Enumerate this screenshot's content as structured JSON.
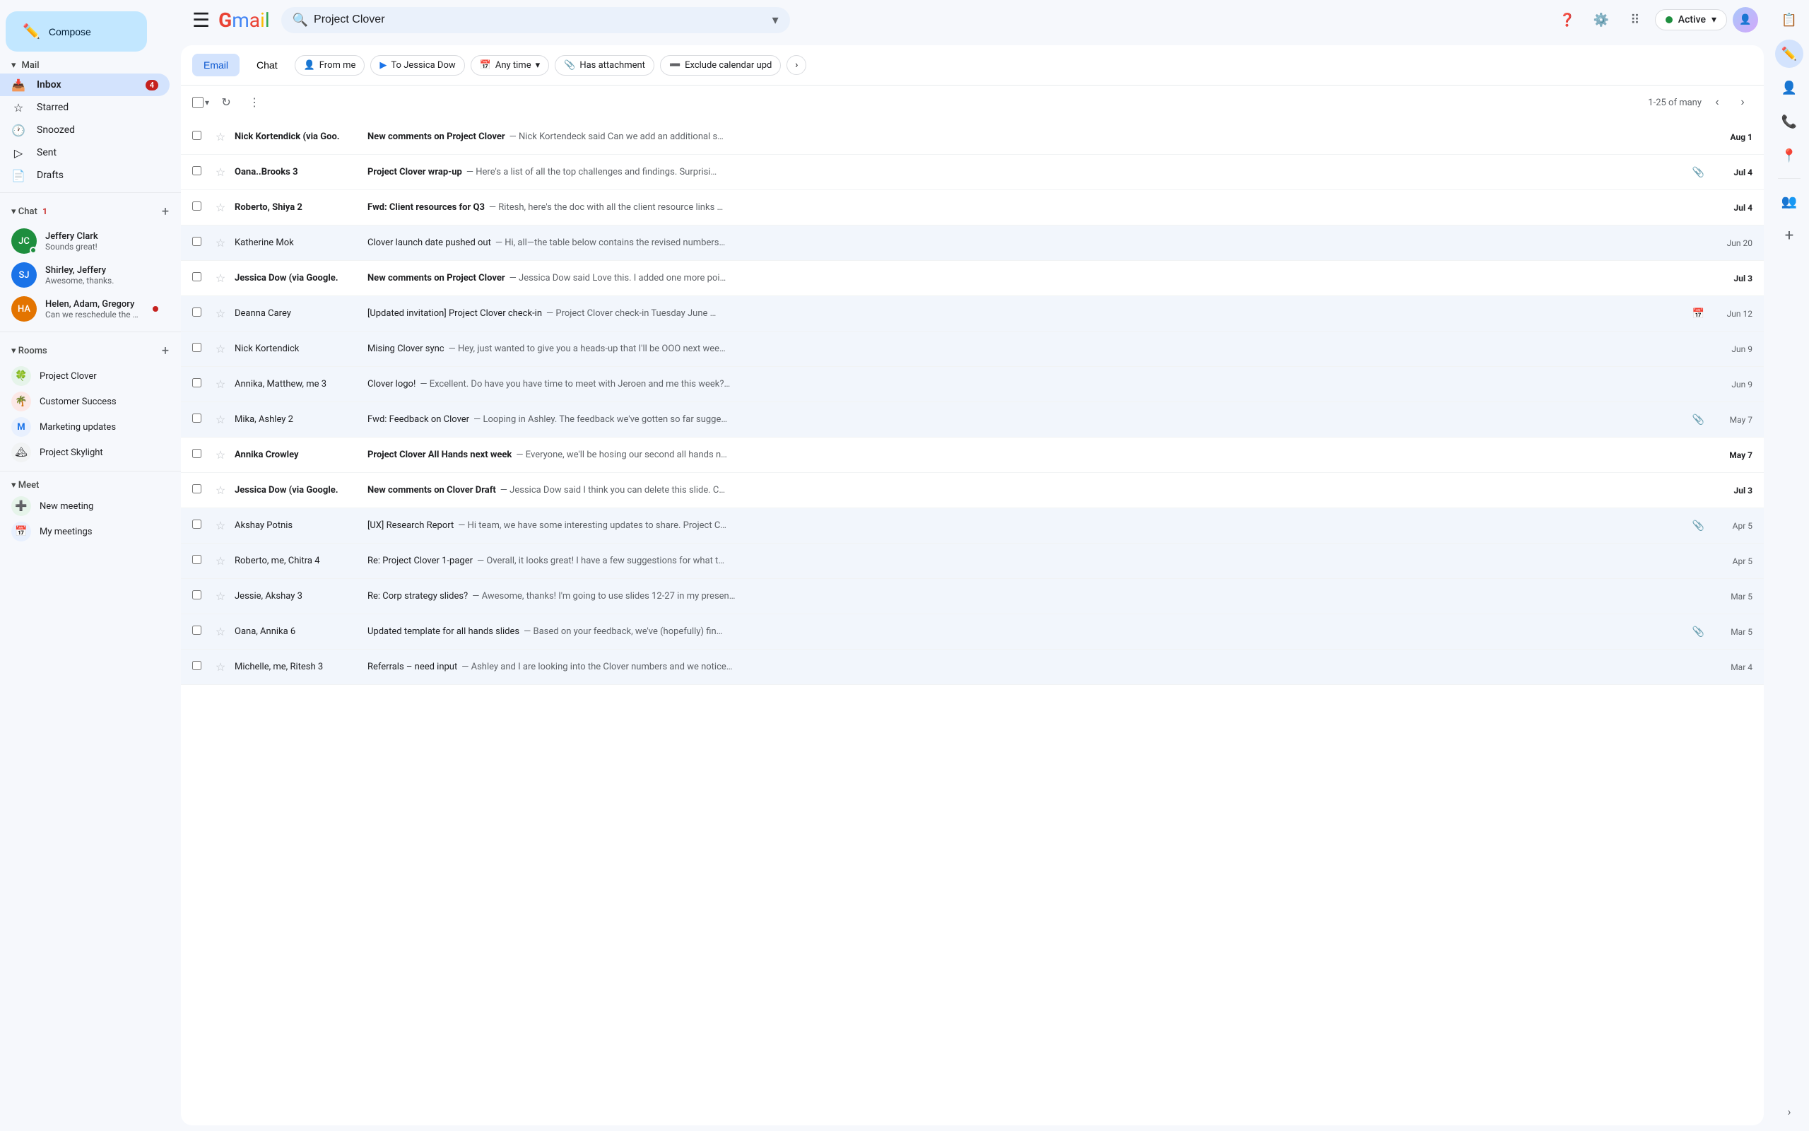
{
  "app": {
    "title": "Gmail",
    "search_placeholder": "Project Clover"
  },
  "header": {
    "status": "Active",
    "status_label": "Active"
  },
  "sidebar": {
    "compose_label": "Compose",
    "mail_section": "Mail",
    "nav_items": [
      {
        "id": "inbox",
        "label": "Inbox",
        "badge": "4",
        "active": true
      },
      {
        "id": "starred",
        "label": "Starred"
      },
      {
        "id": "snoozed",
        "label": "Snoozed"
      },
      {
        "id": "sent",
        "label": "Sent"
      },
      {
        "id": "drafts",
        "label": "Drafts"
      }
    ],
    "chat_section": "Chat",
    "chat_badge": "1",
    "chat_items": [
      {
        "id": "jeffery",
        "name": "Jeffery Clark",
        "preview": "Sounds great!",
        "avatar": "JC",
        "color": "green",
        "online": true
      },
      {
        "id": "shirley",
        "name": "Shirley, Jeffery",
        "preview": "Awesome, thanks.",
        "avatar": "SJ",
        "color": "blue"
      },
      {
        "id": "helen",
        "name": "Helen, Adam, Gregory",
        "preview": "Can we reschedule the meeti...",
        "avatar": "HA",
        "color": "orange",
        "unread": true
      }
    ],
    "rooms_section": "Rooms",
    "rooms": [
      {
        "id": "clover",
        "name": "Project Clover",
        "emoji": "🍀"
      },
      {
        "id": "success",
        "name": "Customer Success",
        "emoji": "🌴"
      },
      {
        "id": "marketing",
        "name": "Marketing updates",
        "emoji": "🇲"
      },
      {
        "id": "skylight",
        "name": "Project Skylight",
        "emoji": "🏔"
      }
    ],
    "meet_section": "Meet",
    "meet_items": [
      {
        "id": "new-meeting",
        "label": "New meeting"
      },
      {
        "id": "my-meetings",
        "label": "My meetings"
      }
    ]
  },
  "filter_bar": {
    "tabs": [
      {
        "id": "email",
        "label": "Email",
        "active": true
      },
      {
        "id": "chat",
        "label": "Chat",
        "active": false
      }
    ],
    "chips": [
      {
        "id": "from-me",
        "label": "From me",
        "icon": "👤"
      },
      {
        "id": "to-jessica",
        "label": "To Jessica Dow",
        "icon": "▶"
      },
      {
        "id": "any-time",
        "label": "Any time",
        "icon": "📅",
        "dropdown": true
      },
      {
        "id": "has-attachment",
        "label": "Has attachment",
        "icon": "📎"
      },
      {
        "id": "exclude-calendar",
        "label": "Exclude calendar upd",
        "icon": "➖"
      }
    ]
  },
  "toolbar": {
    "pagination": "1-25 of many"
  },
  "emails": [
    {
      "id": 1,
      "sender": "Nick Kortendick (via Goo.",
      "bold": true,
      "subject": "New comments on Project Clover",
      "subject_bold": true,
      "preview": "— Nick Kortendeck said Can we add an additional s…",
      "date": "Aug 1",
      "date_bold": true,
      "starred": false,
      "attachment": false
    },
    {
      "id": 2,
      "sender": "Oana..Brooks 3",
      "bold": true,
      "subject": "Project Clover wrap-up",
      "subject_bold": true,
      "preview": "— Here's a list of all the top challenges and findings. Surprisi…",
      "date": "Jul 4",
      "date_bold": true,
      "starred": false,
      "attachment": true
    },
    {
      "id": 3,
      "sender": "Roberto, Shiya 2",
      "bold": true,
      "subject": "Fwd: Client resources for Q3",
      "subject_bold": true,
      "preview": "— Ritesh, here's the doc with all the client resource links …",
      "date": "Jul 4",
      "date_bold": true,
      "starred": false,
      "attachment": false
    },
    {
      "id": 4,
      "sender": "Katherine Mok",
      "bold": false,
      "subject": "Clover launch date pushed out",
      "subject_bold": false,
      "preview": "— Hi, all—the table below contains the revised numbers…",
      "date": "Jun 20",
      "date_bold": false,
      "starred": false,
      "attachment": false
    },
    {
      "id": 5,
      "sender": "Jessica Dow (via Google.",
      "bold": true,
      "subject": "New comments on Project Clover",
      "subject_bold": true,
      "preview": "— Jessica Dow said Love this. I added one more poi…",
      "date": "Jul 3",
      "date_bold": true,
      "starred": false,
      "attachment": false
    },
    {
      "id": 6,
      "sender": "Deanna Carey",
      "bold": false,
      "subject": "[Updated invitation] Project Clover check-in",
      "subject_bold": false,
      "preview": "— Project Clover check-in Tuesday June …",
      "date": "Jun 12",
      "date_bold": false,
      "starred": false,
      "attachment": false,
      "calendar": true
    },
    {
      "id": 7,
      "sender": "Nick Kortendick",
      "bold": false,
      "subject": "Mising Clover sync",
      "subject_bold": false,
      "preview": "— Hey, just wanted to give you a heads-up that I'll be OOO next wee…",
      "date": "Jun 9",
      "date_bold": false,
      "starred": false,
      "attachment": false
    },
    {
      "id": 8,
      "sender": "Annika, Matthew, me 3",
      "bold": false,
      "subject": "Clover logo!",
      "subject_bold": false,
      "preview": "— Excellent. Do have you have time to meet with Jeroen and me this week?…",
      "date": "Jun 9",
      "date_bold": false,
      "starred": false,
      "attachment": false
    },
    {
      "id": 9,
      "sender": "Mika, Ashley 2",
      "bold": false,
      "subject": "Fwd: Feedback on Clover",
      "subject_bold": false,
      "preview": "— Looping in Ashley. The feedback we've gotten so far sugge…",
      "date": "May 7",
      "date_bold": false,
      "starred": false,
      "attachment": true
    },
    {
      "id": 10,
      "sender": "Annika Crowley",
      "bold": true,
      "subject": "Project Clover All Hands next week",
      "subject_bold": true,
      "preview": "— Everyone, we'll be hosing our second all hands n…",
      "date": "May 7",
      "date_bold": true,
      "starred": false,
      "attachment": false
    },
    {
      "id": 11,
      "sender": "Jessica Dow (via Google.",
      "bold": true,
      "subject": "New comments on Clover Draft",
      "subject_bold": true,
      "preview": "— Jessica Dow said I think you can delete this slide. C…",
      "date": "Jul 3",
      "date_bold": true,
      "starred": false,
      "attachment": false
    },
    {
      "id": 12,
      "sender": "Akshay Potnis",
      "bold": false,
      "subject": "[UX] Research Report",
      "subject_bold": false,
      "preview": "— Hi team, we have some interesting updates to share. Project C…",
      "date": "Apr 5",
      "date_bold": false,
      "starred": false,
      "attachment": true
    },
    {
      "id": 13,
      "sender": "Roberto, me, Chitra 4",
      "bold": false,
      "subject": "Re: Project Clover 1-pager",
      "subject_bold": false,
      "preview": "— Overall, it looks great! I have a few suggestions for what t…",
      "date": "Apr 5",
      "date_bold": false,
      "starred": false,
      "attachment": false
    },
    {
      "id": 14,
      "sender": "Jessie, Akshay 3",
      "bold": false,
      "subject": "Re: Corp strategy slides?",
      "subject_bold": false,
      "preview": "— Awesome, thanks! I'm going to use slides 12-27 in my presen…",
      "date": "Mar 5",
      "date_bold": false,
      "starred": false,
      "attachment": false
    },
    {
      "id": 15,
      "sender": "Oana, Annika 6",
      "bold": false,
      "subject": "Updated template for all hands slides",
      "subject_bold": false,
      "preview": "— Based on your feedback, we've (hopefully) fin…",
      "date": "Mar 5",
      "date_bold": false,
      "starred": false,
      "attachment": true
    },
    {
      "id": 16,
      "sender": "Michelle, me, Ritesh 3",
      "bold": false,
      "subject": "Referrals – need input",
      "subject_bold": false,
      "preview": "— Ashley and I are looking into the Clover numbers and we notice…",
      "date": "Mar 4",
      "date_bold": false,
      "starred": false,
      "attachment": false
    }
  ]
}
